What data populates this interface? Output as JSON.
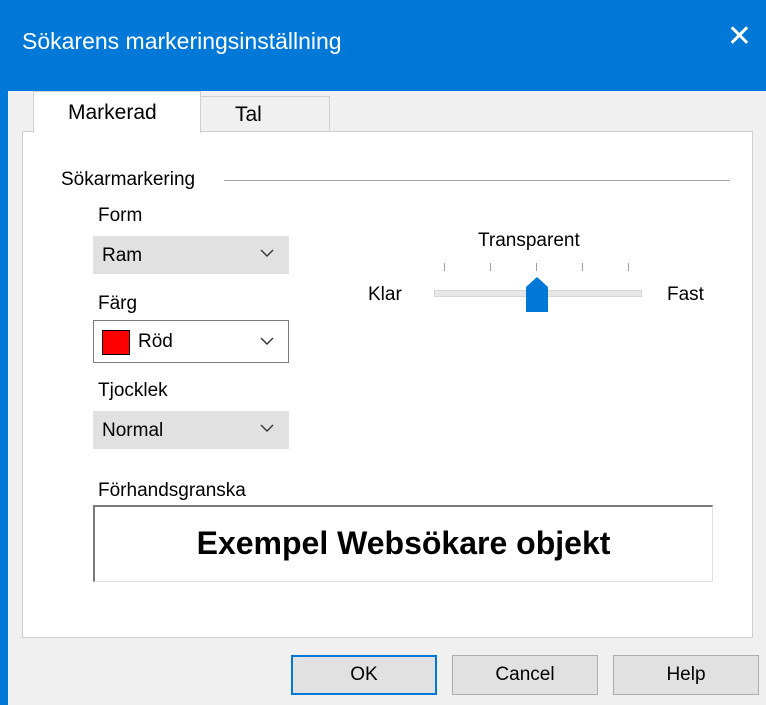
{
  "window": {
    "title": "Sökarens markeringsinställning"
  },
  "tabs": [
    {
      "label": "Markerad",
      "active": true
    },
    {
      "label": "Tal",
      "active": false
    }
  ],
  "group": {
    "label": "Sökarmarkering"
  },
  "form": {
    "shape": {
      "label": "Form",
      "value": "Ram"
    },
    "color": {
      "label": "Färg",
      "value": "Röd",
      "swatch": "#ff0000"
    },
    "thickness": {
      "label": "Tjocklek",
      "value": "Normal"
    }
  },
  "transparency": {
    "label": "Transparent",
    "min_label": "Klar",
    "max_label": "Fast",
    "value_fraction": 0.5
  },
  "preview": {
    "label": "Förhandsgranska",
    "text": "Exempel Websökare objekt"
  },
  "buttons": {
    "ok": "OK",
    "cancel": "Cancel",
    "help": "Help"
  },
  "colors": {
    "titlebar": "#0078d7",
    "accent": "#0078d7"
  }
}
